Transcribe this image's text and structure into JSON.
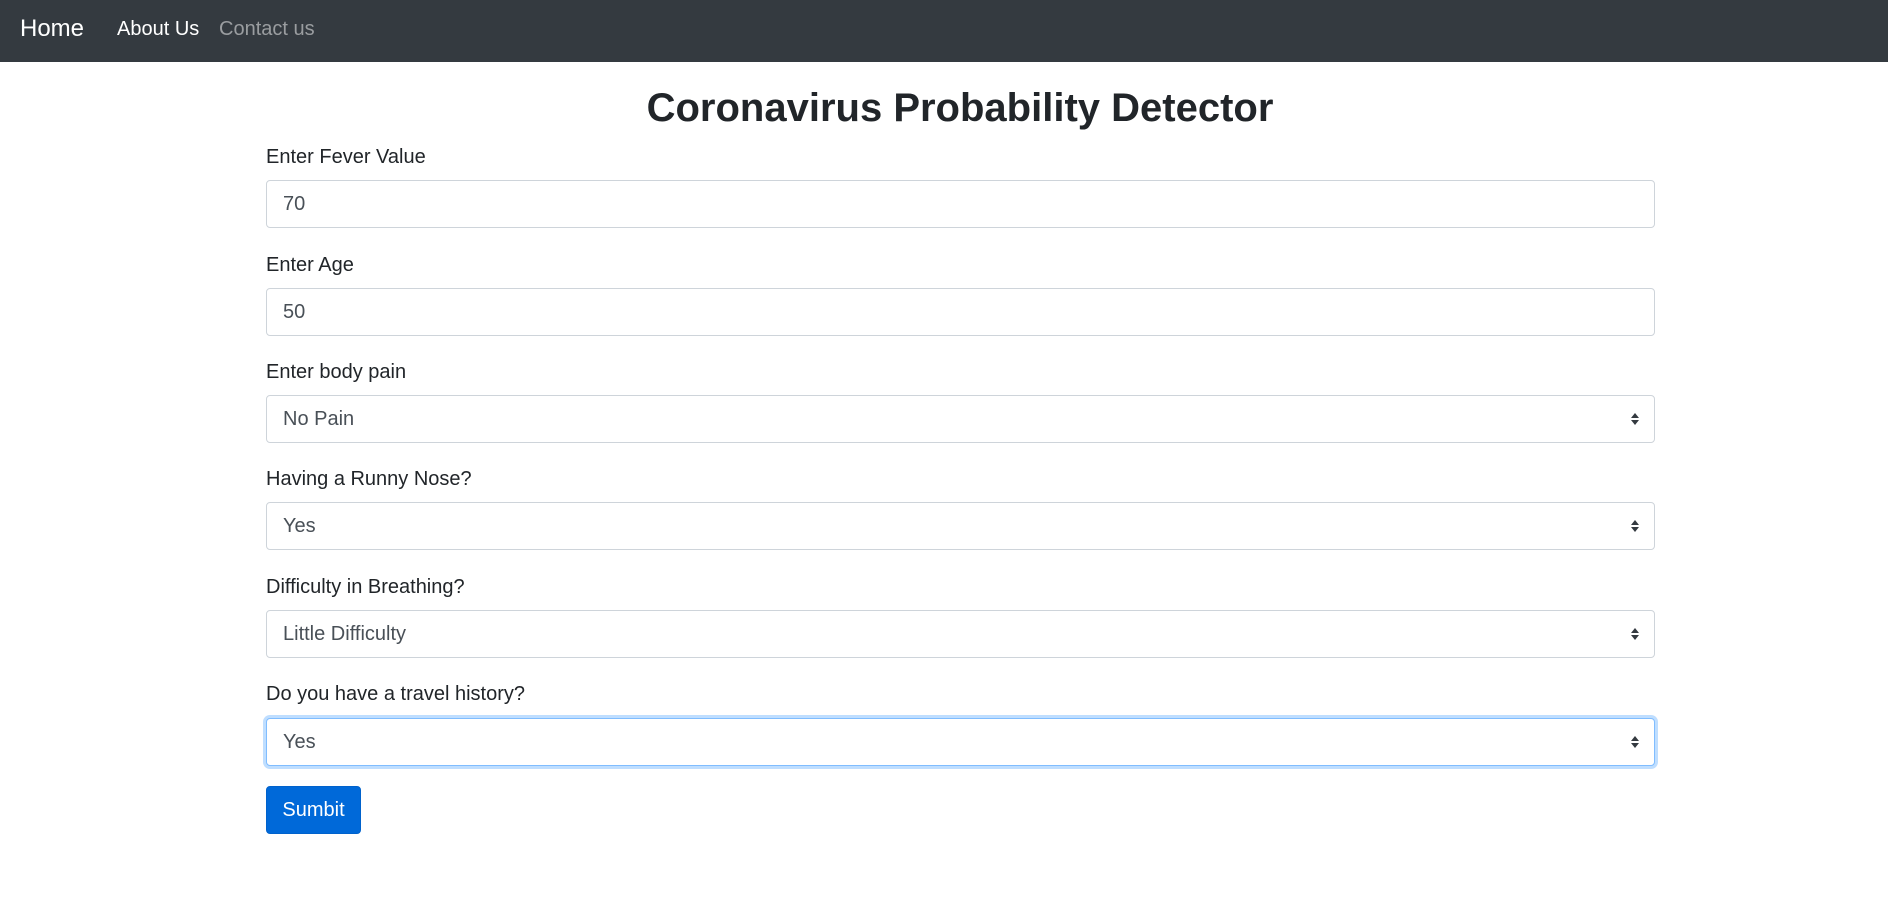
{
  "navbar": {
    "brand": "Home",
    "links": [
      {
        "label": "About Us",
        "active": true
      },
      {
        "label": "Contact us",
        "active": false
      }
    ],
    "background": "#343a40"
  },
  "page": {
    "title": "Coronavirus Probability Detector"
  },
  "form": {
    "fever": {
      "label": "Enter Fever Value",
      "value": "70"
    },
    "age": {
      "label": "Enter Age",
      "value": "50"
    },
    "body_pain": {
      "label": "Enter body pain",
      "value": "No Pain"
    },
    "runny_nose": {
      "label": "Having a Runny Nose?",
      "value": "Yes"
    },
    "breathing": {
      "label": "Difficulty in Breathing?",
      "value": "Little Difficulty"
    },
    "travel_history": {
      "label": "Do you have a travel history?",
      "value": "Yes",
      "focused": true
    },
    "submit_label": "Sumbit"
  },
  "colors": {
    "primary": "#0069d9",
    "focus_border": "#80bdff",
    "field_border": "#ced4da"
  }
}
